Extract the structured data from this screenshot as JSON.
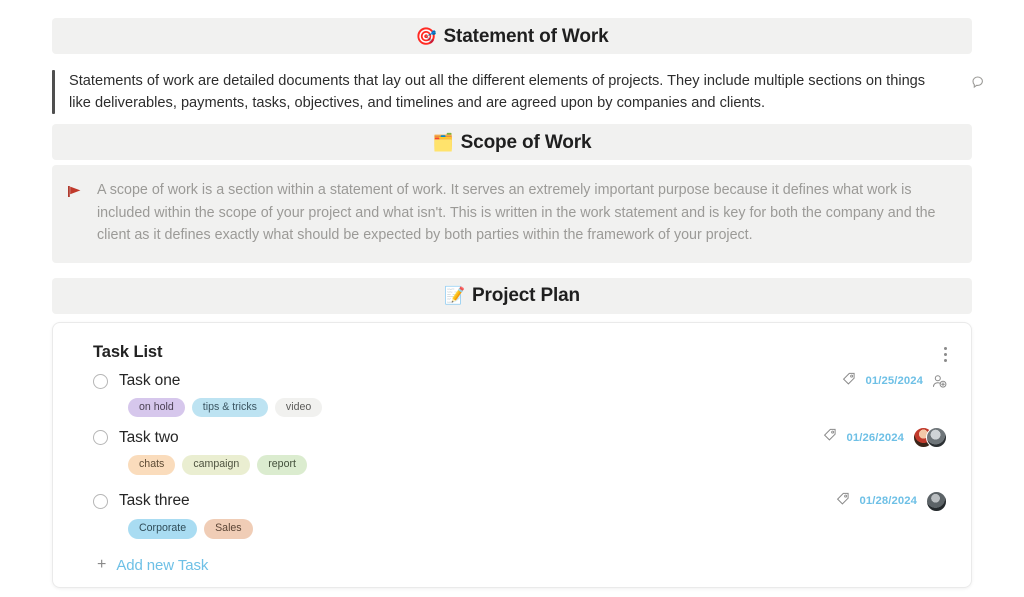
{
  "sections": {
    "statement_of_work": {
      "emoji": "🎯",
      "title": "Statement of Work",
      "body": "Statements of work are detailed documents that lay out all the different elements of projects. They include multiple sections on things like deliverables, payments, tasks, objectives, and timelines and are agreed upon by companies and clients."
    },
    "scope_of_work": {
      "emoji": "🗂️",
      "title": "Scope of Work",
      "body": "A scope of work is a section within a statement of work. It serves an extremely important purpose because it defines what work is included within the scope of your project and what isn't. This is written in the work statement and is key for both the company and the client as it defines exactly what should be expected by both parties within the framework of your project."
    },
    "project_plan": {
      "emoji": "📝",
      "title": "Project Plan"
    }
  },
  "task_card": {
    "title": "Task List",
    "add_task_label": "Add new Task",
    "add_task_plus": "+",
    "tasks": [
      {
        "name": "Task one",
        "date": "01/25/2024",
        "tags": [
          {
            "label": "on hold",
            "bg": "#d6c7ec",
            "color": "#4b4254"
          },
          {
            "label": "tips & tricks",
            "bg": "#bde3f2",
            "color": "#3c5663"
          },
          {
            "label": "video",
            "bg": "#f1f1ef",
            "color": "#5a5a58"
          }
        ],
        "assignee_type": "add-person"
      },
      {
        "name": "Task two",
        "date": "01/26/2024",
        "tags": [
          {
            "label": "chats",
            "bg": "#fadcbc",
            "color": "#5d4b35"
          },
          {
            "label": "campaign",
            "bg": "#eaeed1",
            "color": "#4f5340"
          },
          {
            "label": "report",
            "bg": "#dbeccf",
            "color": "#44513c"
          }
        ],
        "assignee_type": "avatars-2"
      },
      {
        "name": "Task three",
        "date": "01/28/2024",
        "tags": [
          {
            "label": "Corporate",
            "bg": "#a9dcf2",
            "color": "#2f4c58"
          },
          {
            "label": "Sales",
            "bg": "#f0cdb6",
            "color": "#5a4434"
          }
        ],
        "assignee_type": "avatars-1"
      }
    ]
  },
  "colors": {
    "section_header_bg": "#f1f1f0",
    "date_blue": "#6ec0e6",
    "link_blue": "#6ec0e6",
    "muted_text": "#9b9a97",
    "arrow_red": "#c0392b"
  },
  "icons": {
    "comment": "comment-icon",
    "kebab": "more-options-icon",
    "tag": "tag-icon",
    "add_person": "add-person-icon"
  }
}
